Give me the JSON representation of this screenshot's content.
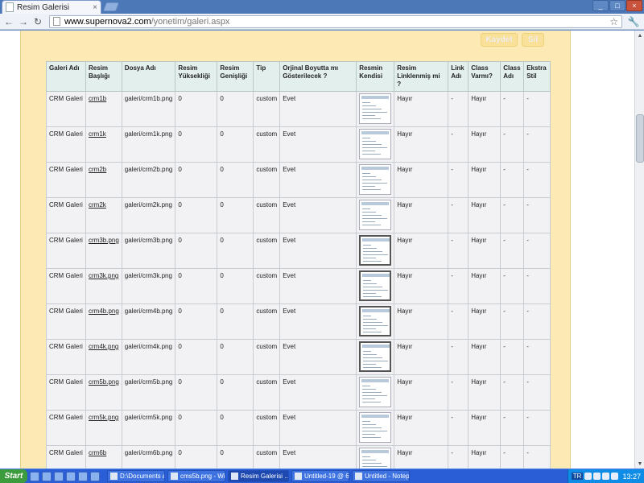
{
  "browser": {
    "tab_title": "Resim Galerisi",
    "tab_close": "×",
    "url_host": "www.supernova2.com",
    "url_path": "/yonetim/galeri.aspx",
    "nav_back": "←",
    "nav_forward": "→",
    "nav_reload": "↻",
    "star": "☆",
    "wrench": "🔧",
    "window_minimize": "_",
    "window_maximize": "□",
    "window_close": "×"
  },
  "actions": {
    "save_label": "Kaydet",
    "delete_label": "Sil"
  },
  "table": {
    "headers": [
      "Galeri Adı",
      "Resim Başlığı",
      "Dosya Adı",
      "Resim Yüksekliği",
      "Resim Genişliği",
      "Tip",
      "Orjinal Boyutta mı Gösterilecek ?",
      "Resmin Kendisi",
      "Resim Linklenmiş mi ?",
      "Link Adı",
      "Class Varmı?",
      "Class Adı",
      "Ekstra Stil"
    ],
    "rows": [
      {
        "gallery": "CRM Galeri",
        "title": "crm1b",
        "file": "galeri/crm1b.png",
        "height": "0",
        "width": "0",
        "type": "custom",
        "original": "Evet",
        "thumb": "light",
        "linked": "Hayır",
        "link": "-",
        "has_class": "Hayır",
        "class_name": "-",
        "style": "-"
      },
      {
        "gallery": "CRM Galeri",
        "title": "crm1k",
        "file": "galeri/crm1k.png",
        "height": "0",
        "width": "0",
        "type": "custom",
        "original": "Evet",
        "thumb": "light",
        "linked": "Hayır",
        "link": "-",
        "has_class": "Hayır",
        "class_name": "-",
        "style": "-"
      },
      {
        "gallery": "CRM Galeri",
        "title": "crm2b",
        "file": "galeri/crm2b.png",
        "height": "0",
        "width": "0",
        "type": "custom",
        "original": "Evet",
        "thumb": "light",
        "linked": "Hayır",
        "link": "-",
        "has_class": "Hayır",
        "class_name": "-",
        "style": "-"
      },
      {
        "gallery": "CRM Galeri",
        "title": "crm2k",
        "file": "galeri/crm2k.png",
        "height": "0",
        "width": "0",
        "type": "custom",
        "original": "Evet",
        "thumb": "light",
        "linked": "Hayır",
        "link": "-",
        "has_class": "Hayır",
        "class_name": "-",
        "style": "-"
      },
      {
        "gallery": "CRM Galeri",
        "title": "crm3b.png",
        "file": "galeri/crm3b.png",
        "height": "0",
        "width": "0",
        "type": "custom",
        "original": "Evet",
        "thumb": "dark",
        "linked": "Hayır",
        "link": "-",
        "has_class": "Hayır",
        "class_name": "-",
        "style": "-"
      },
      {
        "gallery": "CRM Galeri",
        "title": "crm3k.png",
        "file": "galeri/crm3k.png",
        "height": "0",
        "width": "0",
        "type": "custom",
        "original": "Evet",
        "thumb": "dark",
        "linked": "Hayır",
        "link": "-",
        "has_class": "Hayır",
        "class_name": "-",
        "style": "-"
      },
      {
        "gallery": "CRM Galeri",
        "title": "crm4b.png",
        "file": "galeri/crm4b.png",
        "height": "0",
        "width": "0",
        "type": "custom",
        "original": "Evet",
        "thumb": "dark",
        "linked": "Hayır",
        "link": "-",
        "has_class": "Hayır",
        "class_name": "-",
        "style": "-"
      },
      {
        "gallery": "CRM Galeri",
        "title": "crm4k.png",
        "file": "galeri/crm4k.png",
        "height": "0",
        "width": "0",
        "type": "custom",
        "original": "Evet",
        "thumb": "dark",
        "linked": "Hayır",
        "link": "-",
        "has_class": "Hayır",
        "class_name": "-",
        "style": "-"
      },
      {
        "gallery": "CRM Galeri",
        "title": "crm5b.png",
        "file": "galeri/crm5b.png",
        "height": "0",
        "width": "0",
        "type": "custom",
        "original": "Evet",
        "thumb": "light",
        "linked": "Hayır",
        "link": "-",
        "has_class": "Hayır",
        "class_name": "-",
        "style": "-"
      },
      {
        "gallery": "CRM Galeri",
        "title": "crm5k.png",
        "file": "galeri/crm5k.png",
        "height": "0",
        "width": "0",
        "type": "custom",
        "original": "Evet",
        "thumb": "light",
        "linked": "Hayır",
        "link": "-",
        "has_class": "Hayır",
        "class_name": "-",
        "style": "-"
      },
      {
        "gallery": "CRM Galeri",
        "title": "crm6b",
        "file": "galeri/crm6b.png",
        "height": "0",
        "width": "0",
        "type": "custom",
        "original": "Evet",
        "thumb": "light",
        "linked": "Hayır",
        "link": "-",
        "has_class": "Hayır",
        "class_name": "-",
        "style": "-"
      }
    ]
  },
  "taskbar": {
    "start_label": "Start",
    "tasks": [
      "D:\\Documents a...",
      "cms5b.png - Win...",
      "Resim Galerisi ...",
      "Untitled-19 @ 6...",
      "Untitled - Notepad"
    ],
    "active_task": "Resim Galerisi ...",
    "language": "TR",
    "clock": "13:27"
  },
  "colors": {
    "page_background": "#fde9b4",
    "header_background": "#e3efec",
    "cell_background": "#f2f2f4",
    "button_background": "#fae19a"
  }
}
